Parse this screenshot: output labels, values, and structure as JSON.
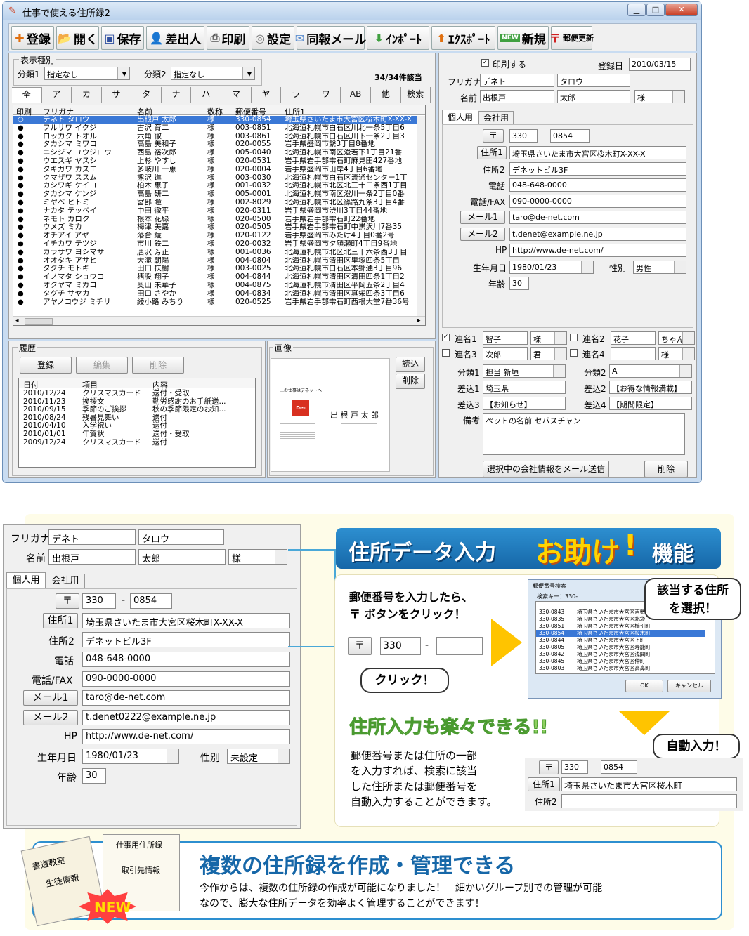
{
  "window": {
    "title": "仕事で使える住所録2"
  },
  "toolbar": {
    "buttons": [
      {
        "label": "登録",
        "icon": "plus-icon",
        "color": "#e07010"
      },
      {
        "label": "開く",
        "icon": "folder-icon",
        "color": "#e0a020"
      },
      {
        "label": "保存",
        "icon": "floppy-icon",
        "color": "#3050a0"
      },
      {
        "label": "差出人",
        "icon": "person-icon",
        "color": "#3060c0"
      },
      {
        "label": "印刷",
        "icon": "printer-icon",
        "color": "#555"
      },
      {
        "label": "設定",
        "icon": "gear-icon",
        "color": "#777"
      },
      {
        "label": "同報メール",
        "icon": "mail-icon",
        "color": "#6090d0"
      },
      {
        "label": "ｲﾝﾎﾟｰﾄ",
        "icon": "arrow-down-icon",
        "color": "#40a040"
      },
      {
        "label": "ｴｸｽﾎﾟｰﾄ",
        "icon": "arrow-up-icon",
        "color": "#e07010"
      },
      {
        "label": "新規",
        "icon": "new-badge-icon",
        "color": "#40a040"
      },
      {
        "label": "郵便更新",
        "icon": "postal-mark-icon",
        "color": "#d02020"
      }
    ]
  },
  "filter": {
    "group_label": "表示種別",
    "cat1_label": "分類1",
    "cat1_value": "指定なし",
    "cat2_label": "分類2",
    "cat2_value": "指定なし",
    "count": "34/34件該当"
  },
  "kana_tabs": [
    "全",
    "ア",
    "カ",
    "サ",
    "タ",
    "ナ",
    "ハ",
    "マ",
    "ヤ",
    "ラ",
    "ワ",
    "AB",
    "他",
    "検索"
  ],
  "grid": {
    "headers": [
      "印刷",
      "フリガナ",
      "名前",
      "敬称",
      "郵便番号",
      "住所1"
    ],
    "rows": [
      [
        "テネト タロウ",
        "出根戸 太郎",
        "様",
        "330-0854",
        "埼玉県さいたま市大宮区桜木町X-XX-X"
      ],
      [
        "フルサワ イクジ",
        "古沢 育二",
        "様",
        "003-0851",
        "北海道札幌市白石区川北一条5丁目6"
      ],
      [
        "ロッカク トオル",
        "六角 徹",
        "様",
        "003-0861",
        "北海道札幌市白石区川下一条2丁目3"
      ],
      [
        "タカシマ ミワコ",
        "高島 美和子",
        "様",
        "020-0055",
        "岩手県盛岡市繋3丁目8番地"
      ],
      [
        "ニシジマ ユウジロウ",
        "西島 裕次郎",
        "様",
        "005-0040",
        "北海道札幌市南区澄若下1丁目21番"
      ],
      [
        "ウエスギ ヤスシ",
        "上杉 やすし",
        "様",
        "020-0531",
        "岩手県岩手郡雫石町麻見田427番地"
      ],
      [
        "タキガワ カズエ",
        "多岐川 一恵",
        "様",
        "020-0004",
        "岩手県盛岡市山岸4丁目6番地"
      ],
      [
        "クマザワ ススム",
        "熊沢 進",
        "様",
        "003-0030",
        "北海道札幌市白石区流通センター1丁"
      ],
      [
        "カシワギ ケイコ",
        "柏木 恵子",
        "様",
        "001-0032",
        "北海道札幌市北区北三十二条西1丁目"
      ],
      [
        "タカシマ ケンジ",
        "高島 研二",
        "様",
        "005-0001",
        "北海道札幌市南区澄川一条2丁目0番"
      ],
      [
        "ミヤベ ヒトミ",
        "宮部 瞳",
        "様",
        "002-8029",
        "北海道札幌市北区篠路九条3丁目4番"
      ],
      [
        "ナカタ テッペイ",
        "中田 徹平",
        "様",
        "020-0311",
        "岩手県盛岡市渋川3丁目44番地"
      ],
      [
        "ネモト カロク",
        "根本 花緑",
        "様",
        "020-0500",
        "岩手県岩手郡雫石町22番地"
      ],
      [
        "ウメズ ミカ",
        "梅津 美嘉",
        "様",
        "020-0505",
        "岩手県岩手郡雫石町中黒沢川7番35"
      ],
      [
        "オチアイ アヤ",
        "落合 綾",
        "様",
        "020-0122",
        "岩手県盛岡市みたけ4丁目0番2号"
      ],
      [
        "イチカワ テツジ",
        "市川 鉄二",
        "様",
        "020-0032",
        "岩手県盛岡市夕顔瀬町4丁目9番地"
      ],
      [
        "カラサワ ヨシマサ",
        "唐沢 芳正",
        "様",
        "001-0036",
        "北海道札幌市北区北三十六条西3丁目"
      ],
      [
        "オオタキ アサヒ",
        "大滝 朝陽",
        "様",
        "004-0804",
        "北海道札幌市清田区里塚四条5丁目"
      ],
      [
        "タグチ モトキ",
        "田口 扶樹",
        "様",
        "003-0025",
        "北海道札幌市白石区本郷通3丁目96"
      ],
      [
        "イノマタ ショウコ",
        "猪股 翔子",
        "様",
        "004-0844",
        "北海道札幌市清田区清田四条1丁目2"
      ],
      [
        "オクヤマ ミカコ",
        "奥山 未華子",
        "様",
        "004-0875",
        "北海道札幌市清田区平岡五条2丁目4"
      ],
      [
        "タグチ サヤカ",
        "田口 さやか",
        "様",
        "004-0834",
        "北海道札幌市清田区真栄四条3丁目6"
      ],
      [
        "アヤノコウジ ミチリ",
        "綾小路 みちり",
        "様",
        "020-0525",
        "岩手県岩手郡雫石町西根大堂7番36号"
      ]
    ]
  },
  "history": {
    "group_label": "履歴",
    "register_label": "登録",
    "edit_label": "編集",
    "delete_label": "削除",
    "headers": [
      "日付",
      "項目",
      "内容"
    ],
    "rows": [
      [
        "2010/12/24",
        "クリスマスカード",
        "送付・受取"
      ],
      [
        "2010/11/23",
        "挨拶文",
        "勤労感謝のお手紙送..."
      ],
      [
        "2010/09/15",
        "季節のご挨拶",
        "秋の季節限定のお知..."
      ],
      [
        "2010/08/24",
        "残暑見舞い",
        "送付"
      ],
      [
        "2010/04/10",
        "入学祝い",
        "送付"
      ],
      [
        "2010/01/01",
        "年賀状",
        "送付・受取"
      ],
      [
        "2009/12/24",
        "クリスマスカード",
        "送付"
      ]
    ]
  },
  "image_panel": {
    "group_label": "画像",
    "load_label": "読込",
    "delete_label": "削除",
    "card_name": "出 根 戸 太 郎",
    "card_tagline": "…お仕事はデネットへ！",
    "card_logo": "De-Net"
  },
  "detail": {
    "print_label": "印刷する",
    "reg_date_label": "登録日",
    "reg_date": "2010/03/15",
    "furigana_label": "フリガナ",
    "furigana_last": "デネト",
    "furigana_first": "タロウ",
    "name_label": "名前",
    "name_last": "出根戸",
    "name_first": "太郎",
    "honorific": "様",
    "tab_personal": "個人用",
    "tab_company": "会社用",
    "postal_button": "〒",
    "zip1": "330",
    "zip2": "0854",
    "addr1_button": "住所1",
    "addr1": "埼玉県さいたま市大宮区桜木町X-XX-X",
    "addr2_label": "住所2",
    "addr2": "デネットビル3F",
    "tel_label": "電話",
    "tel": "048-648-0000",
    "fax_label": "電話/FAX",
    "fax": "090-0000-0000",
    "mail1_button": "メール1",
    "mail1": "taro@de-net.com",
    "mail2_button": "メール2",
    "mail2": "t.denet@example.ne.jp",
    "hp_label": "HP",
    "hp": "http://www.de-net.com/",
    "birth_label": "生年月日",
    "birth": "1980/01/23",
    "sex_label": "性別",
    "sex": "男性",
    "age_label": "年齢",
    "age": "30",
    "joint1_label": "連名1",
    "joint1": "智子",
    "joint1_h": "様",
    "joint2_label": "連名2",
    "joint2": "花子",
    "joint2_h": "ちゃん",
    "joint3_label": "連名3",
    "joint3": "次郎",
    "joint3_h": "君",
    "joint4_label": "連名4",
    "joint4": "",
    "joint4_h": "様",
    "cat1_label": "分類1",
    "cat1": "担当 新垣",
    "cat2_label": "分類2",
    "cat2": "A",
    "ins1_label": "差込1",
    "ins1": "埼玉県",
    "ins2_label": "差込2",
    "ins2": "【お得な情報満載】",
    "ins3_label": "差込3",
    "ins3": "【お知らせ】",
    "ins4_label": "差込4",
    "ins4": "【期間限定】",
    "note_label": "備考",
    "note": "ペットの名前 セバスチャン",
    "send_mail_button": "選択中の会社情報をメール送信",
    "delete_button": "削除"
  },
  "zoom": {
    "furigana_label": "フリガナ",
    "furigana_last": "デネト",
    "furigana_first": "タロウ",
    "name_label": "名前",
    "name_last": "出根戸",
    "name_first": "太郎",
    "honorific": "様",
    "tab_personal": "個人用",
    "tab_company": "会社用",
    "postal_button": "〒",
    "zip1": "330",
    "zip2": "0854",
    "addr1_button": "住所1",
    "addr1": "埼玉県さいたま市大宮区桜木町X-XX-X",
    "addr2_label": "住所2",
    "addr2": "デネットビル3F",
    "tel_label": "電話",
    "tel": "048-648-0000",
    "fax_label": "電話/FAX",
    "fax": "090-0000-0000",
    "mail1_button": "メール1",
    "mail1": "taro@de-net.com",
    "mail2_button": "メール2",
    "mail2": "t.denet0222@example.ne.jp",
    "hp_label": "HP",
    "hp": "http://www.de-net.com/",
    "birth_label": "生年月日",
    "birth": "1980/01/23",
    "sex_label": "性別",
    "sex": "未設定",
    "age_label": "年齢",
    "age": "30"
  },
  "feature1": {
    "title_a": "住所データ入力",
    "title_b": "お助け",
    "title_c": "!",
    "title_d": "機能",
    "step1": "郵便番号を入力したら、\n〒 ボタンをクリック！",
    "click_bubble": "クリック！",
    "postal_button": "〒",
    "zip1": "330",
    "zip2": "",
    "dialog_title": "郵便番号検索",
    "dialog_key": "検索キー：330-",
    "dialog_rows": [
      [
        "330-0843",
        "埼玉県さいたま市大宮区吉敷"
      ],
      [
        "330-0835",
        "埼玉県さいたま市大宮区北袋"
      ],
      [
        "330-0851",
        "埼玉県さいたま市大宮区櫛引町"
      ],
      [
        "330-0854",
        "埼玉県さいたま市大宮区桜木町"
      ],
      [
        "330-0844",
        "埼玉県さいたま市大宮区下町"
      ],
      [
        "330-0805",
        "埼玉県さいたま市大宮区寿能町"
      ],
      [
        "330-0842",
        "埼玉県さいたま市大宮区浅間町"
      ],
      [
        "330-0845",
        "埼玉県さいたま市大宮区仲町"
      ],
      [
        "330-0803",
        "埼玉県さいたま市大宮区高鼻町"
      ]
    ],
    "dialog_ok": "OK",
    "dialog_cancel": "キャンセル",
    "select_bubble": "該当する住所\nを選択！",
    "easy_title": "住所入力も楽々できる!!",
    "auto_bubble": "自動入力！",
    "desc": "郵便番号または住所の一部\nを入力すれば、検索に該当\nした住所または郵便番号を\n自動入力することができます。",
    "auto_postal_button": "〒",
    "auto_zip1": "330",
    "auto_zip2": "0854",
    "auto_addr1_button": "住所1",
    "auto_addr1": "埼玉県さいたま市大宮区桜木町",
    "auto_addr2_label": "住所2",
    "auto_addr2": ""
  },
  "feature2": {
    "book1": "書道教室",
    "book2": "生徒情報",
    "book3": "仕事用住所録",
    "book4": "取引先情報",
    "new_badge": "NEW",
    "title": "複数の住所録を作成・管理できる",
    "text": "今作からは、複数の住所録の作成が可能になりました！　細かいグループ別での管理が可能\nなので、膨大な住所データを効率よく管理することができます！"
  }
}
